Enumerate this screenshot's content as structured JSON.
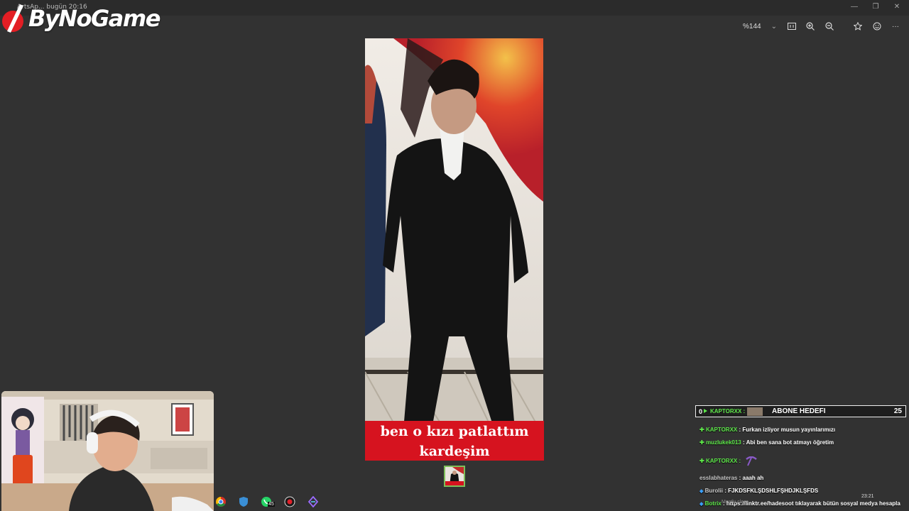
{
  "window": {
    "title": "ArtsAp... bugün 20:16",
    "minimize": "—",
    "restore": "❐",
    "close": "✕"
  },
  "overlay_logo": {
    "text": "ByNoGame"
  },
  "viewer_toolbar": {
    "zoom_level": "%144",
    "zoom_dropdown": "⌄",
    "icons": [
      "actual-size-icon",
      "zoom-in-icon",
      "zoom-out-icon",
      "favorite-icon",
      "emoji-icon",
      "more-icon"
    ],
    "more_label": "···"
  },
  "image": {
    "caption_line1": "ben o kızı patlattım",
    "caption_line2": "kardeşim"
  },
  "goal_bar": {
    "prefix": "0",
    "user": "KAPTORXX :",
    "label": "ABONE HEDEFI",
    "count": "25"
  },
  "chat": {
    "messages": [
      {
        "user": "KAPTORXX",
        "text": ": Furkan izliyor musun yayınlarımızı"
      },
      {
        "user": "muzlukek013",
        "text": ": Abi ben sana bot atmayı öğretim"
      },
      {
        "user": "KAPTORXX :",
        "text": ""
      },
      {
        "user": "esslabhateras",
        "text": ": aaah ah"
      },
      {
        "user": "Burolii",
        "text": ": FJKDSFKLŞDSHLFŞHDJKLŞFDS"
      },
      {
        "user": "Botrix",
        "text": ": https://linktr.ee/hadesoot tıklayarak bütün sosyal medya hesapla"
      }
    ]
  },
  "taskbar": {
    "whatsapp_badge": "45",
    "clock": "23:21",
    "weather_text": "Mostly clear"
  },
  "colors": {
    "background": "#323232",
    "caption_bg": "#d6131f",
    "chat_user": "#5ee84a"
  }
}
